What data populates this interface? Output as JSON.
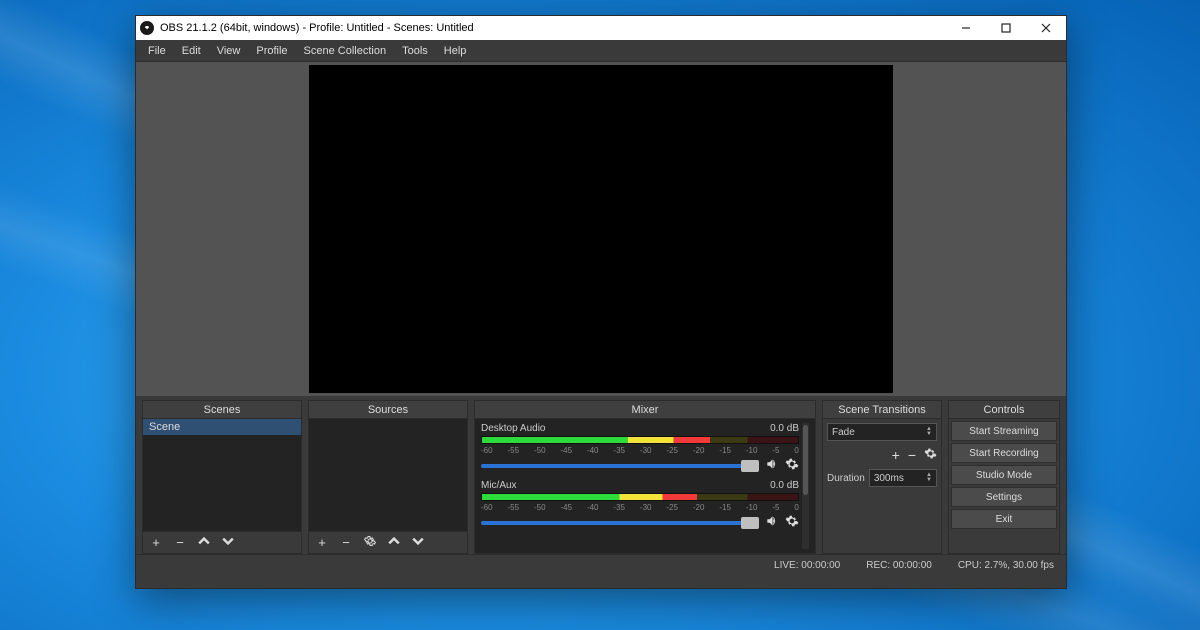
{
  "titlebar": {
    "title": "OBS 21.1.2 (64bit, windows) - Profile: Untitled - Scenes: Untitled"
  },
  "menu": {
    "items": [
      "File",
      "Edit",
      "View",
      "Profile",
      "Scene Collection",
      "Tools",
      "Help"
    ]
  },
  "docks": {
    "scenes": {
      "header": "Scenes",
      "items": [
        "Scene"
      ]
    },
    "sources": {
      "header": "Sources",
      "items": []
    },
    "mixer": {
      "header": "Mixer",
      "ticks": [
        "-60",
        "-55",
        "-50",
        "-45",
        "-40",
        "-35",
        "-30",
        "-25",
        "-20",
        "-15",
        "-10",
        "-5",
        "0"
      ],
      "tracks": [
        {
          "name": "Desktop Audio",
          "db": "0.0 dB",
          "level_pct": 72
        },
        {
          "name": "Mic/Aux",
          "db": "0.0 dB",
          "level_pct": 68
        }
      ]
    },
    "transitions": {
      "header": "Scene Transitions",
      "selected": "Fade",
      "duration_label": "Duration",
      "duration_value": "300ms"
    },
    "controls": {
      "header": "Controls",
      "buttons": [
        "Start Streaming",
        "Start Recording",
        "Studio Mode",
        "Settings",
        "Exit"
      ]
    }
  },
  "status": {
    "live": "LIVE: 00:00:00",
    "rec": "REC: 00:00:00",
    "cpu": "CPU: 2.7%, 30.00 fps"
  }
}
